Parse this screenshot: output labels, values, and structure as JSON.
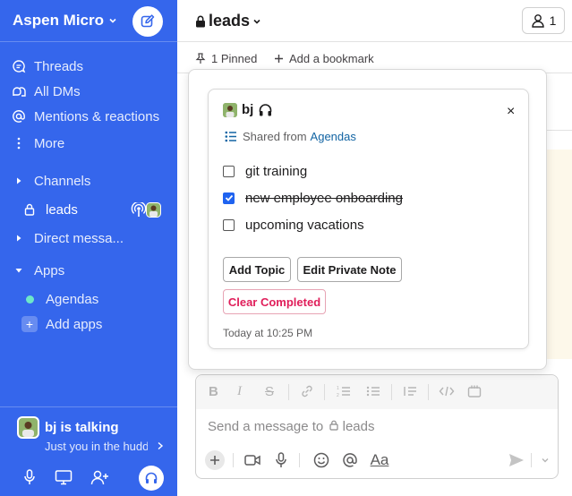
{
  "sidebar": {
    "workspace_name": "Aspen Micro",
    "nav": [
      {
        "label": "Threads",
        "icon": "threads-icon"
      },
      {
        "label": "All DMs",
        "icon": "dms-icon"
      },
      {
        "label": "Mentions & reactions",
        "icon": "at-icon"
      },
      {
        "label": "More",
        "icon": "more-icon"
      }
    ],
    "sections": {
      "channels": "Channels",
      "leads": "leads",
      "direct_messages": "Direct messa...",
      "apps": "Apps",
      "agendas": "Agendas",
      "add_apps": "Add apps",
      "add_symbol": "+"
    },
    "call": {
      "title": "bj is talking",
      "subtitle": "Just you in the huddle"
    },
    "colors": {
      "sidebar_bg": "#3566ec",
      "app_dot": "#6ee7c8"
    }
  },
  "channel": {
    "name": "leads",
    "member_count": "1",
    "pinned": "1 Pinned",
    "add_bookmark": "Add a bookmark"
  },
  "composer": {
    "placeholder_prefix": "Send a message to",
    "placeholder_channel": "leads",
    "format_label": "Aa"
  },
  "card": {
    "user": "bj",
    "close_symbol": "×",
    "shared_from": "Shared from",
    "source_app": "Agendas",
    "items": [
      {
        "text": "git training",
        "checked": false
      },
      {
        "text": "new employee onboarding",
        "checked": true
      },
      {
        "text": "upcoming vacations",
        "checked": false
      }
    ],
    "buttons": {
      "add_topic": "Add Topic",
      "edit_note": "Edit Private Note",
      "clear_completed": "Clear Completed"
    },
    "timestamp": "Today at 10:25 PM",
    "colors": {
      "checkbox_checked": "#1f63f0",
      "clear_button": "#e01e5a",
      "link": "#1264a3"
    }
  }
}
